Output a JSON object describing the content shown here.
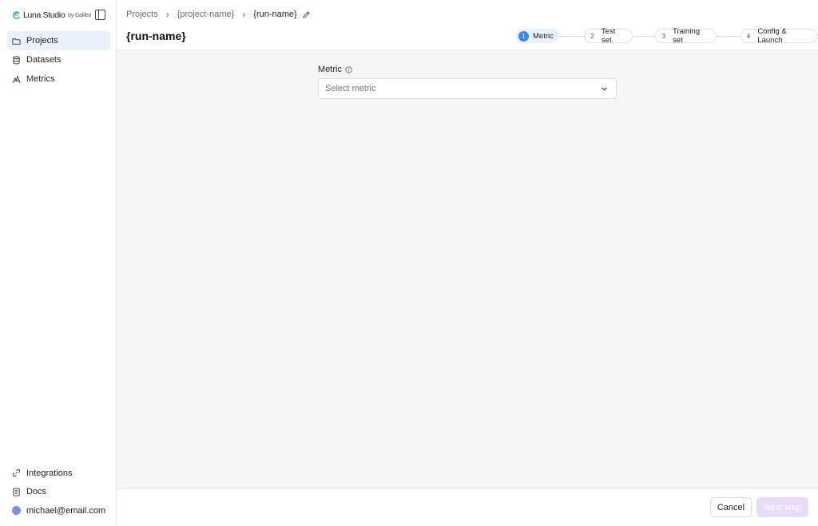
{
  "brand": {
    "name": "Luna Studio",
    "by": "by Galileo"
  },
  "sidebar": {
    "items": [
      {
        "label": "Projects",
        "icon": "folder-icon",
        "active": true
      },
      {
        "label": "Datasets",
        "icon": "database-icon",
        "active": false
      },
      {
        "label": "Metrics",
        "icon": "metrics-icon",
        "active": false
      }
    ],
    "bottom_items": [
      {
        "label": "Integrations",
        "icon": "link-icon"
      },
      {
        "label": "Docs",
        "icon": "document-icon"
      },
      {
        "label": "michael@email.com",
        "icon": "avatar"
      }
    ]
  },
  "breadcrumb": {
    "projects": "Projects",
    "project": "{project-name}",
    "run": "{run-name}"
  },
  "page": {
    "title": "{run-name}"
  },
  "stepper": {
    "steps": [
      {
        "num": "1",
        "label": "Metric",
        "active": true
      },
      {
        "num": "2",
        "label": "Test set",
        "active": false
      },
      {
        "num": "3",
        "label": "Training set",
        "active": false
      },
      {
        "num": "4",
        "label": "Config & Launch",
        "active": false
      }
    ]
  },
  "form": {
    "metric_label": "Metric",
    "metric_placeholder": "Select metric"
  },
  "footer": {
    "cancel_label": "Cancel",
    "next_label": "Next step"
  },
  "colors": {
    "accent": "#3b82f6",
    "active_nav_bg": "#e9f1fc",
    "next_disabled_bg": "#e9dcfb",
    "logo": "#2aa6e0",
    "avatar": "#7b8ff0"
  }
}
